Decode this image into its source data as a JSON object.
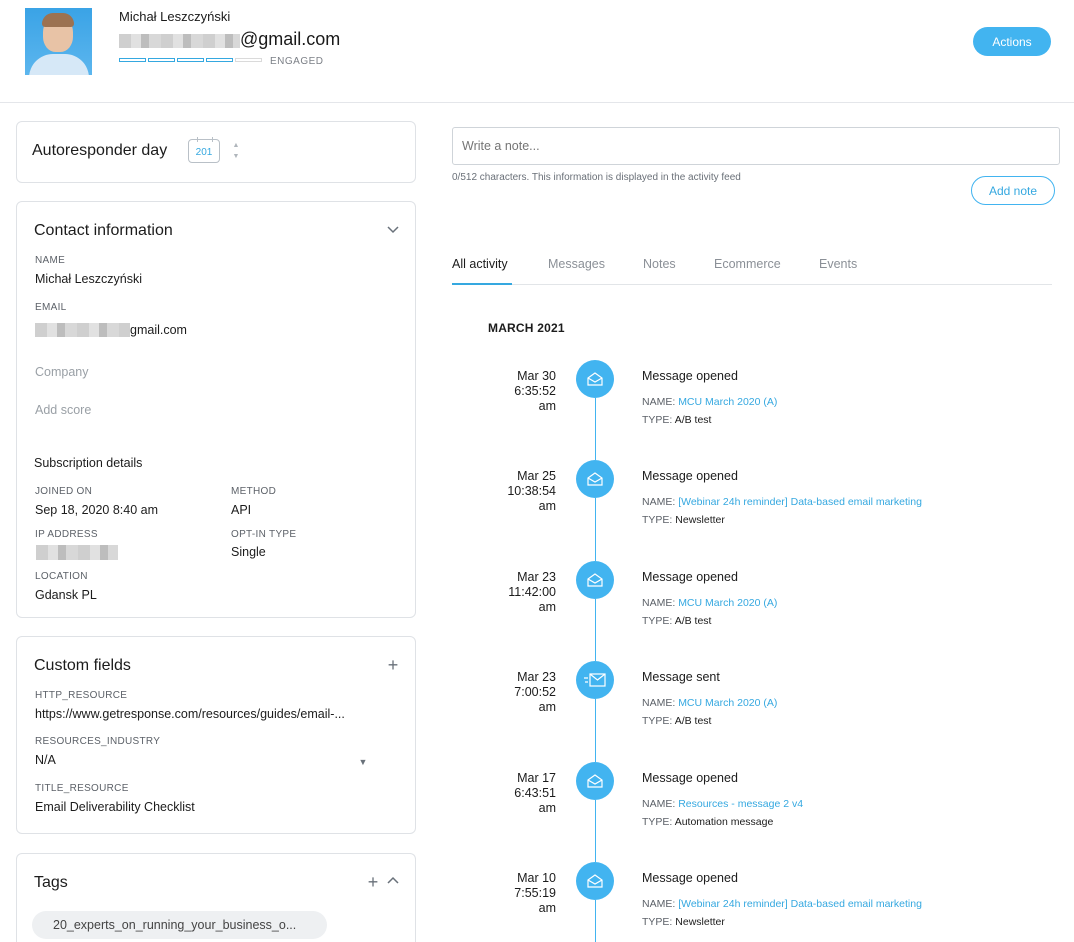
{
  "header": {
    "name": "Michał Leszczyński",
    "email_suffix": "@gmail.com",
    "engagement_label": "ENGAGED",
    "engagement_level": 4,
    "engagement_max": 5,
    "actions_label": "Actions"
  },
  "autoresponder": {
    "title": "Autoresponder day",
    "value": "201"
  },
  "contact": {
    "title": "Contact information",
    "name_label": "NAME",
    "name_value": "Michał Leszczyński",
    "email_label": "EMAIL",
    "email_suffix": "gmail.com",
    "company_placeholder": "Company",
    "score_placeholder": "Add score",
    "subscription_title": "Subscription details",
    "joined_label": "JOINED ON",
    "joined_value": "Sep 18, 2020 8:40 am",
    "method_label": "METHOD",
    "method_value": "API",
    "ip_label": "IP ADDRESS",
    "optin_label": "OPT-IN TYPE",
    "optin_value": "Single",
    "location_label": "LOCATION",
    "location_value": "Gdansk PL"
  },
  "custom_fields": {
    "title": "Custom fields",
    "f1_label": "HTTP_RESOURCE",
    "f1_value": "https://www.getresponse.com/resources/guides/email-...",
    "f2_label": "RESOURCES_INDUSTRY",
    "f2_value": "N/A",
    "f3_label": "TITLE_RESOURCE",
    "f3_value": "Email Deliverability Checklist"
  },
  "tags": {
    "title": "Tags",
    "items": [
      "20_experts_on_running_your_business_o..."
    ]
  },
  "note": {
    "placeholder": "Write a note...",
    "hint": "0/512 characters. This information is displayed in the activity feed",
    "add_label": "Add note"
  },
  "tabs": [
    "All activity",
    "Messages",
    "Notes",
    "Ecommerce",
    "Events"
  ],
  "activity": {
    "month": "MARCH 2021",
    "name_prefix": "NAME:",
    "type_prefix": "TYPE:",
    "events": [
      {
        "date": "Mar 30",
        "time": "6:35:52",
        "ampm": "am",
        "title": "Message opened",
        "name": "MCU March 2020 (A)",
        "type": "A/B test",
        "icon": "envelope-open-icon"
      },
      {
        "date": "Mar 25",
        "time": "10:38:54",
        "ampm": "am",
        "title": "Message opened",
        "name": "[Webinar 24h reminder] Data-based email marketing",
        "type": "Newsletter",
        "icon": "envelope-open-icon"
      },
      {
        "date": "Mar 23",
        "time": "11:42:00",
        "ampm": "am",
        "title": "Message opened",
        "name": "MCU March 2020 (A)",
        "type": "A/B test",
        "icon": "envelope-open-icon"
      },
      {
        "date": "Mar 23",
        "time": "7:00:52",
        "ampm": "am",
        "title": "Message sent",
        "name": "MCU March 2020 (A)",
        "type": "A/B test",
        "icon": "envelope-sent-icon"
      },
      {
        "date": "Mar 17",
        "time": "6:43:51",
        "ampm": "am",
        "title": "Message opened",
        "name": "Resources - message 2 v4",
        "type": "Automation message",
        "icon": "envelope-open-icon"
      },
      {
        "date": "Mar 10",
        "time": "7:55:19",
        "ampm": "am",
        "title": "Message opened",
        "name": "[Webinar 24h reminder] Data-based email marketing",
        "type": "Newsletter",
        "icon": "envelope-open-icon"
      }
    ]
  },
  "colors": {
    "accent": "#42b4f0",
    "link": "#35a8e0"
  }
}
